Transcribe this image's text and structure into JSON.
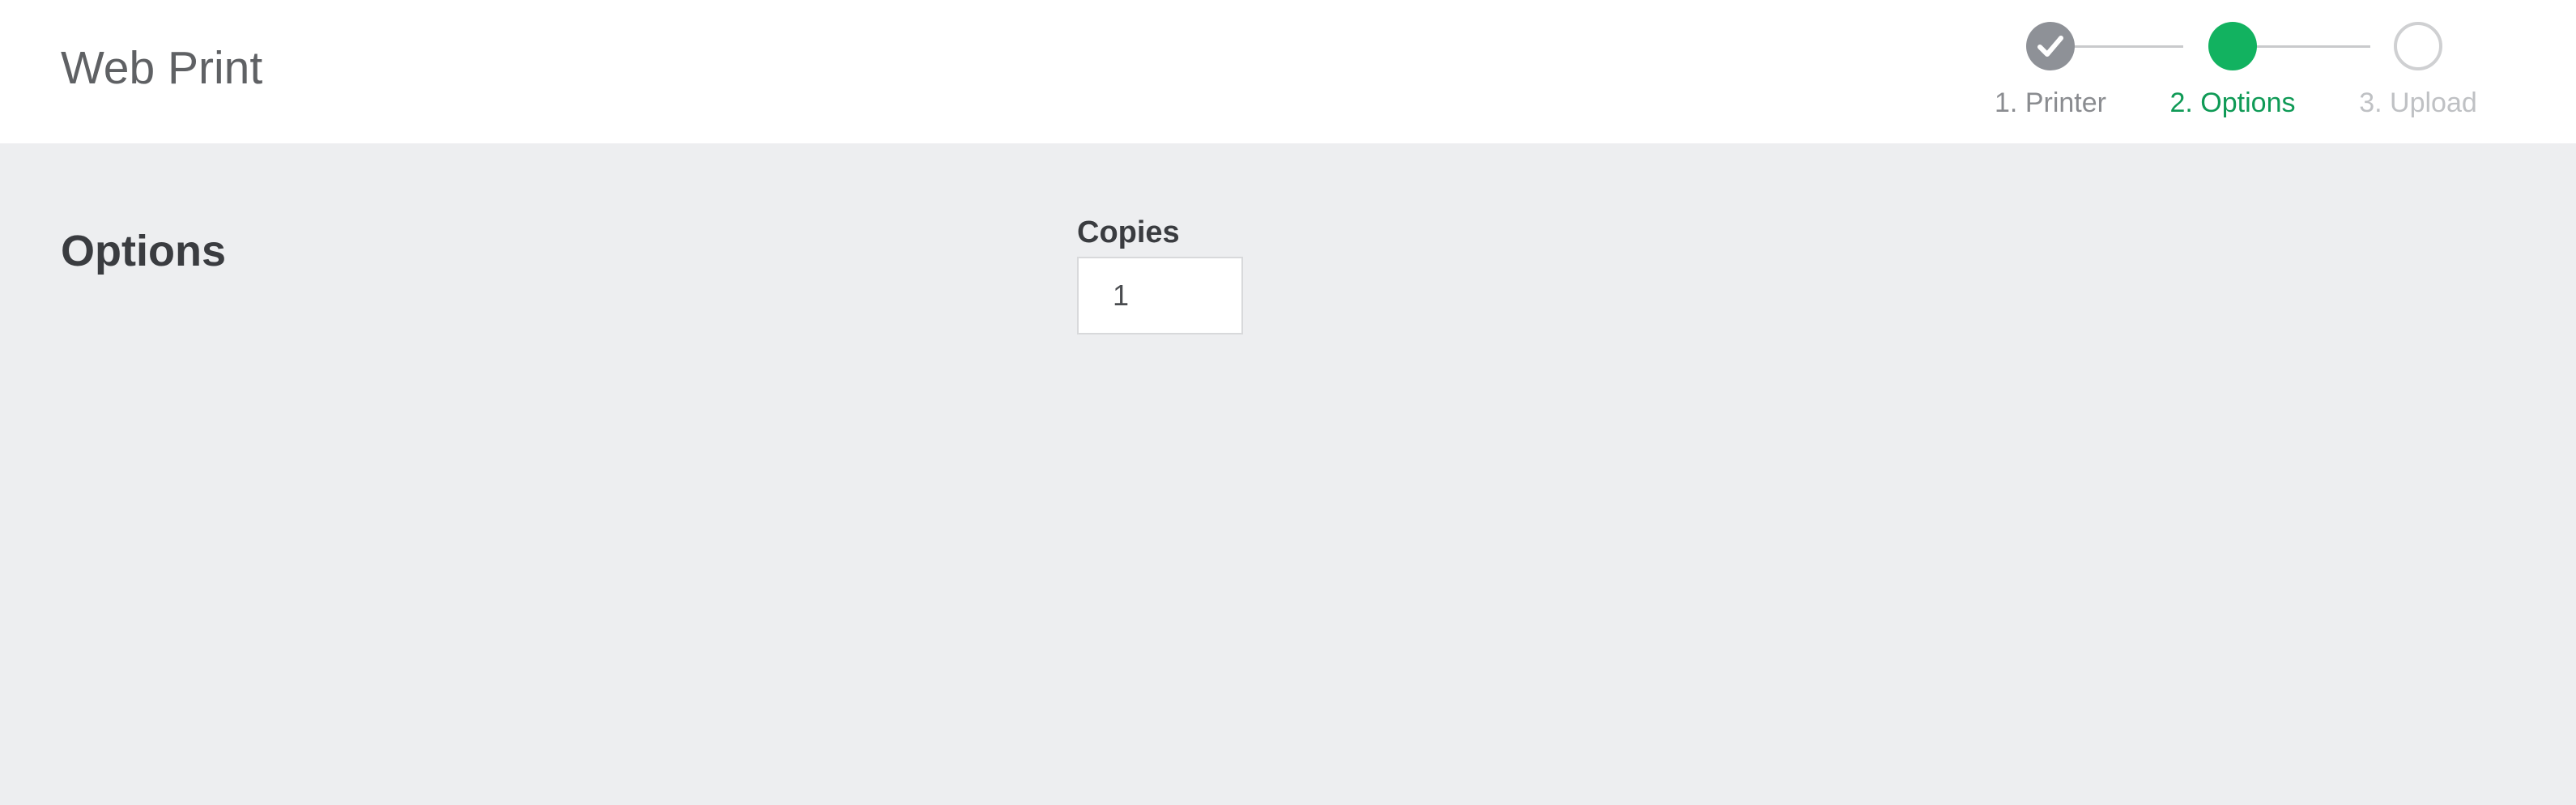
{
  "header": {
    "title": "Web Print"
  },
  "stepper": {
    "steps": [
      {
        "label": "1. Printer",
        "state": "done",
        "icon": "checkmark-icon"
      },
      {
        "label": "2. Options",
        "state": "active"
      },
      {
        "label": "3. Upload",
        "state": "pending"
      }
    ]
  },
  "main": {
    "section_title": "Options",
    "copies": {
      "label": "Copies",
      "value": "1"
    }
  },
  "colors": {
    "active": "#12b260",
    "done": "#8e9197",
    "pending": "#cfd0d2",
    "background": "#edeef0"
  }
}
